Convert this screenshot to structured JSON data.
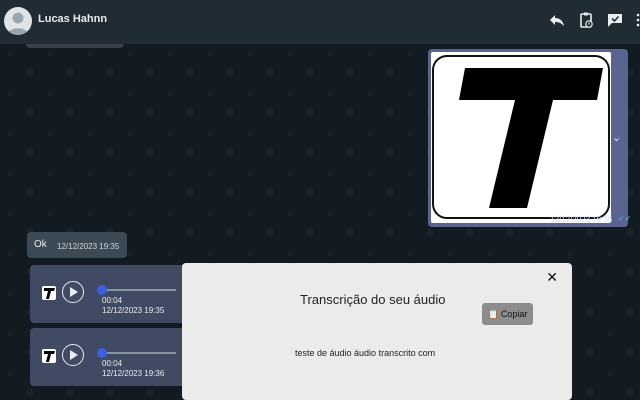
{
  "header": {
    "contact_name": "Lucas Hahnn",
    "icons": [
      "reply-icon",
      "clipboard-clock-icon",
      "chat-check-icon",
      "more-vertical-icon"
    ]
  },
  "image_message": {
    "logo_letter": "T",
    "timestamp": "12/12/2023 19:35",
    "status": "✓✓"
  },
  "text_message": {
    "text": "Ok",
    "timestamp": "12/12/2023 19:35"
  },
  "audio_messages": [
    {
      "duration": "00:04",
      "timestamp": "12/12/2023 19:35",
      "logo_letter": "T"
    },
    {
      "duration": "00:04",
      "timestamp": "12/12/2023 19:36",
      "logo_letter": "T"
    }
  ],
  "modal": {
    "title": "Transcrição do seu áudio",
    "copy_label": "Copiar",
    "transcript": "teste de áudio áudio transcrito com",
    "close_symbol": "✕"
  },
  "colors": {
    "header_bg": "#202c33",
    "outgoing_bubble": "#5b6491",
    "audio_bubble": "#404a63",
    "progress_knob": "#3b5fe0",
    "modal_bg": "#ebebeb"
  }
}
